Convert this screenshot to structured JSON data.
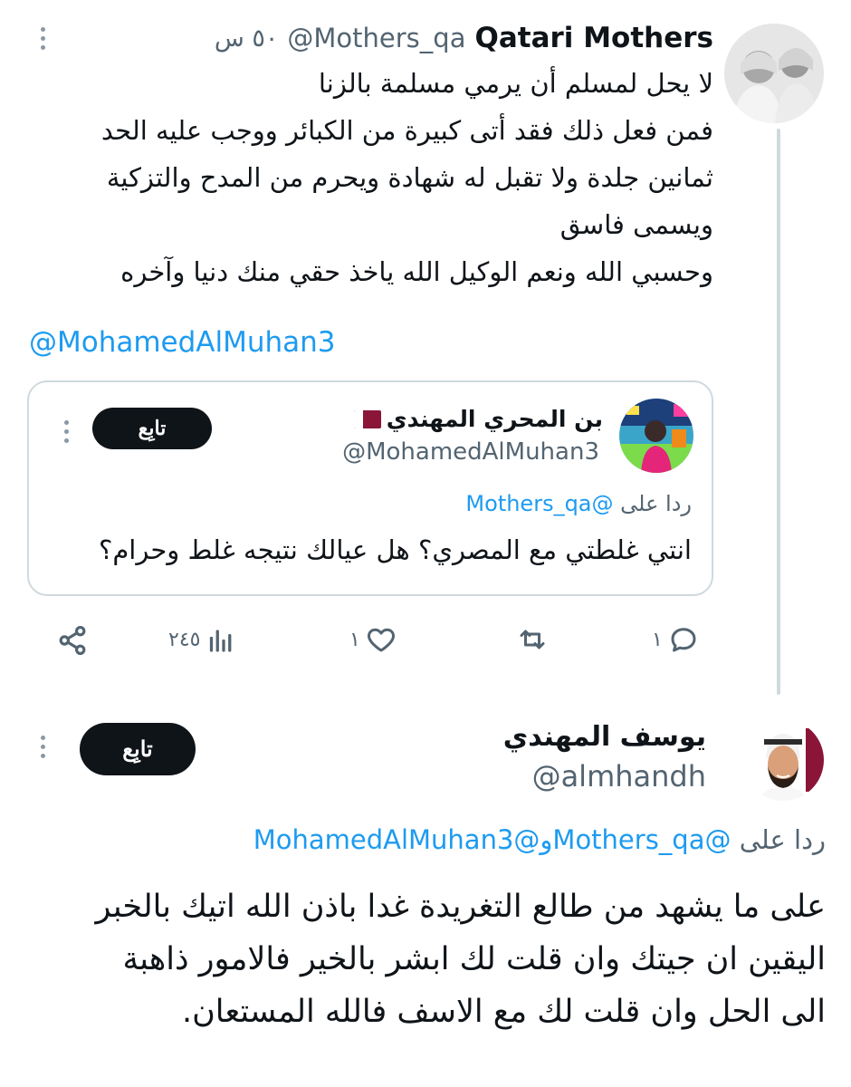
{
  "colors": {
    "text": "#0f1419",
    "secondary": "#536471",
    "link": "#1d9bf0",
    "border": "#cfd9de",
    "button_bg": "#0f1419"
  },
  "tweet1": {
    "name": "Qatari Mothers",
    "handle": "@Mothers_qa",
    "time": "٥٠ س",
    "lines": [
      "لا يحل لمسلم أن يرمي مسلمة بالزنا",
      "فمن فعل ذلك فقد أتى كبيرة من الكبائر ووجب عليه الحد",
      "ثمانين جلدة ولا تقبل له شهادة ويحرم من المدح والتزكية",
      "ويسمى  فاسق",
      "وحسبي الله ونعم الوكيل الله ياخذ حقي منك دنيا وآخره"
    ],
    "mention": "@MohamedAlMuhan3",
    "actions": {
      "replies": "١",
      "likes": "١",
      "views": "٢٤٥"
    }
  },
  "quote": {
    "name": "بن المحري المهندي",
    "handle": "@MohamedAlMuhan3",
    "follow_label": "تابِع",
    "reply_prefix": "ردا على",
    "reply_to": "@Mothers_qa",
    "text": "انتي غلطتي مع المصري؟ هل عيالك نتيجه غلط وحرام؟"
  },
  "tweet2": {
    "name": "يوسف المهندي",
    "handle": "@almhandh",
    "follow_label": "تابِع",
    "reply_prefix": "ردا على",
    "reply_to_1": "@Mothers_qa",
    "reply_joiner": "و",
    "reply_to_2": "@MohamedAlMuhan3",
    "lines": [
      "على ما يشهد من طالع التغريدة غدا باذن الله اتيك بالخبر",
      "اليقين ان جيتك وان قلت لك ابشر بالخير فالامور ذاهبة",
      "الى الحل وان قلت لك مع الاسف فالله المستعان."
    ]
  }
}
